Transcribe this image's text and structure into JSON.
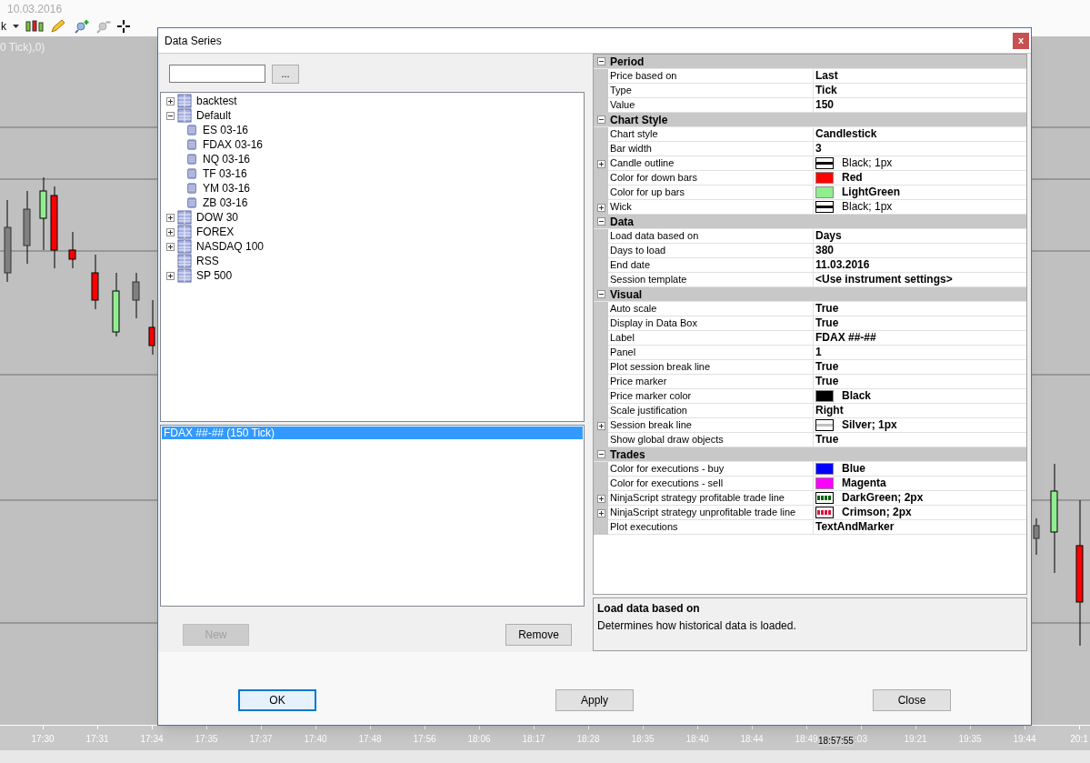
{
  "app": {
    "date_label": "10.03.2016",
    "instrument_menu": "k",
    "chart_label": "0 Tick),0)",
    "time_axis": [
      "17:30",
      "17:31",
      "17:34",
      "17:35",
      "17:37",
      "17:40",
      "17:48",
      "17:56",
      "18:06",
      "18:17",
      "18:28",
      "18:35",
      "18:40",
      "18:44",
      "18:49",
      ":03",
      "19:21",
      "19:35",
      "19:44",
      "20:1"
    ],
    "crosshair_time": "18:57:55"
  },
  "dialog": {
    "title": "Data Series",
    "close_glyph": "x",
    "browse_button": "...",
    "tree": [
      {
        "label": "backtest",
        "expanded": false
      },
      {
        "label": "Default",
        "expanded": true,
        "children": [
          {
            "label": "ES 03-16"
          },
          {
            "label": "FDAX 03-16"
          },
          {
            "label": "NQ 03-16"
          },
          {
            "label": "TF 03-16"
          },
          {
            "label": "YM 03-16"
          },
          {
            "label": "ZB 03-16"
          }
        ]
      },
      {
        "label": "DOW 30",
        "expanded": false
      },
      {
        "label": "FOREX",
        "expanded": false
      },
      {
        "label": "NASDAQ 100",
        "expanded": false
      },
      {
        "label": "RSS"
      },
      {
        "label": "SP 500",
        "expanded": false
      }
    ],
    "series_list": [
      {
        "label": "FDAX ##-## (150 Tick)",
        "selected": true
      }
    ],
    "new_button": {
      "label": "New",
      "disabled": true
    },
    "remove_button": {
      "label": "Remove",
      "disabled": false
    },
    "properties": [
      {
        "category": "Period",
        "expanded": true,
        "rows": [
          {
            "name": "Price based on",
            "value": "Last"
          },
          {
            "name": "Type",
            "value": "Tick"
          },
          {
            "name": "Value",
            "value": "150"
          }
        ]
      },
      {
        "category": "Chart Style",
        "expanded": true,
        "rows": [
          {
            "name": "Chart style",
            "value": "Candlestick"
          },
          {
            "name": "Bar width",
            "value": "3"
          },
          {
            "name": "Candle outline",
            "value": "Black; 1px",
            "expanded": false,
            "bold": false,
            "swatch": {
              "kind": "line",
              "color": "#000000"
            }
          },
          {
            "name": "Color for down bars",
            "value": "Red",
            "swatch": {
              "kind": "fill",
              "color": "#ff0000"
            }
          },
          {
            "name": "Color for up bars",
            "value": "LightGreen",
            "swatch": {
              "kind": "fill",
              "color": "#90ee90"
            }
          },
          {
            "name": "Wick",
            "value": "Black; 1px",
            "expanded": false,
            "bold": false,
            "swatch": {
              "kind": "line",
              "color": "#000000"
            }
          }
        ]
      },
      {
        "category": "Data",
        "expanded": true,
        "rows": [
          {
            "name": "Load data based on",
            "value": "Days"
          },
          {
            "name": "Days to load",
            "value": "380"
          },
          {
            "name": "End date",
            "value": "11.03.2016"
          },
          {
            "name": "Session template",
            "value": "<Use instrument settings>"
          }
        ]
      },
      {
        "category": "Visual",
        "expanded": true,
        "rows": [
          {
            "name": "Auto scale",
            "value": "True"
          },
          {
            "name": "Display in Data Box",
            "value": "True"
          },
          {
            "name": "Label",
            "value": "FDAX ##-##"
          },
          {
            "name": "Panel",
            "value": "1"
          },
          {
            "name": "Plot session break line",
            "value": "True"
          },
          {
            "name": "Price marker",
            "value": "True"
          },
          {
            "name": "Price marker color",
            "value": "Black",
            "swatch": {
              "kind": "fill",
              "color": "#000000"
            }
          },
          {
            "name": "Scale justification",
            "value": "Right"
          },
          {
            "name": "Session break line",
            "value": "Silver; 1px",
            "expanded": false,
            "swatch": {
              "kind": "line",
              "color": "#c0c0c0"
            }
          },
          {
            "name": "Show global draw objects",
            "value": "True"
          }
        ]
      },
      {
        "category": "Trades",
        "expanded": true,
        "rows": [
          {
            "name": "Color for executions - buy",
            "value": "Blue",
            "swatch": {
              "kind": "fill",
              "color": "#0000ff"
            }
          },
          {
            "name": "Color for executions - sell",
            "value": "Magenta",
            "swatch": {
              "kind": "fill",
              "color": "#ff00ff"
            }
          },
          {
            "name": "NinjaScript strategy profitable trade line",
            "value": "DarkGreen; 2px",
            "expanded": false,
            "swatch": {
              "kind": "dotted",
              "color": "#006400"
            }
          },
          {
            "name": "NinjaScript strategy unprofitable trade line",
            "value": "Crimson; 2px",
            "expanded": false,
            "swatch": {
              "kind": "dotted",
              "color": "#dc143c"
            }
          },
          {
            "name": "Plot executions",
            "value": "TextAndMarker"
          }
        ]
      }
    ],
    "description": {
      "title": "Load data based on",
      "text": "Determines how historical data is loaded."
    },
    "footer_buttons": [
      {
        "label": "OK",
        "default": true
      },
      {
        "label": "Apply",
        "default": false
      },
      {
        "label": "Close",
        "default": false
      }
    ]
  }
}
